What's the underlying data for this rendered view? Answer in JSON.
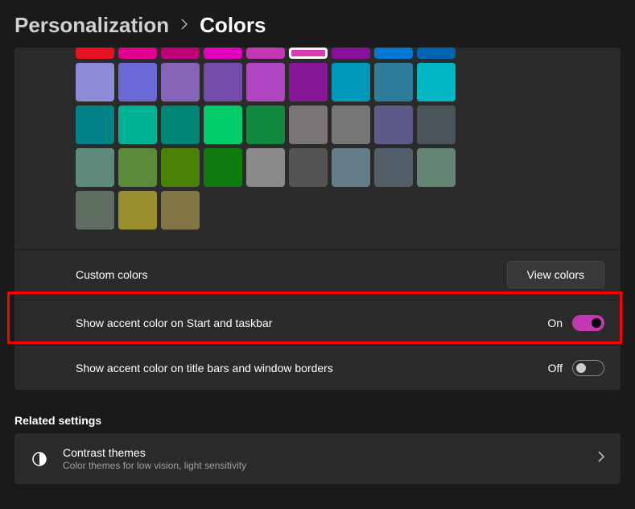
{
  "breadcrumb": {
    "parent": "Personalization",
    "current": "Colors"
  },
  "accent_colors": {
    "row0": [
      "#e81224",
      "#e3008c",
      "#bf0077",
      "#e300bc",
      "#c239b3",
      "#da3ab3",
      "#891098",
      "#0078d4",
      "#0063b1"
    ],
    "row1": [
      "#8e8cd8",
      "#6b69d6",
      "#8764b8",
      "#744da9",
      "#b146c2",
      "#881798",
      "#0099bc",
      "#2d7d9a",
      "#00b7c3"
    ],
    "row2": [
      "#038387",
      "#00b294",
      "#018574",
      "#00cc6a",
      "#10893e",
      "#7a7574",
      "#767676",
      "#5d5a88",
      "#4a5459"
    ],
    "row3": [
      "#5e8a7e",
      "#5b8a3a",
      "#498205",
      "#107c10",
      "#8a8a8a",
      "#545454",
      "#647c8a",
      "#525e68",
      "#648573"
    ],
    "row4": [
      "#5e6e60",
      "#9a8f2e",
      "#847545"
    ],
    "selected_index": 5
  },
  "custom_colors": {
    "label": "Custom colors",
    "button": "View colors"
  },
  "accent_start": {
    "label": "Show accent color on Start and taskbar",
    "state": "On",
    "value": true
  },
  "accent_title": {
    "label": "Show accent color on title bars and window borders",
    "state": "Off",
    "value": false
  },
  "related": {
    "section": "Related settings",
    "contrast": {
      "title": "Contrast themes",
      "subtitle": "Color themes for low vision, light sensitivity"
    }
  }
}
